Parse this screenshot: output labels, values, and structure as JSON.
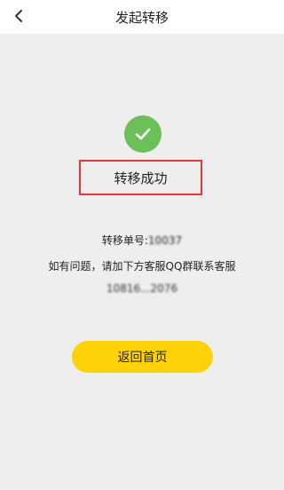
{
  "header": {
    "title": "发起转移",
    "back_icon": "chevron-left-icon"
  },
  "result": {
    "icon": "check-circle-icon",
    "icon_color": "#6cc05a",
    "status": "转移成功",
    "order_label": "转移单号:",
    "order_number": "10037",
    "help_text": "如有问题，请加下方客服QQ群联系客服",
    "qq_group": "10816...2076"
  },
  "actions": {
    "home_label": "返回首页",
    "home_color": "#ffd208"
  }
}
